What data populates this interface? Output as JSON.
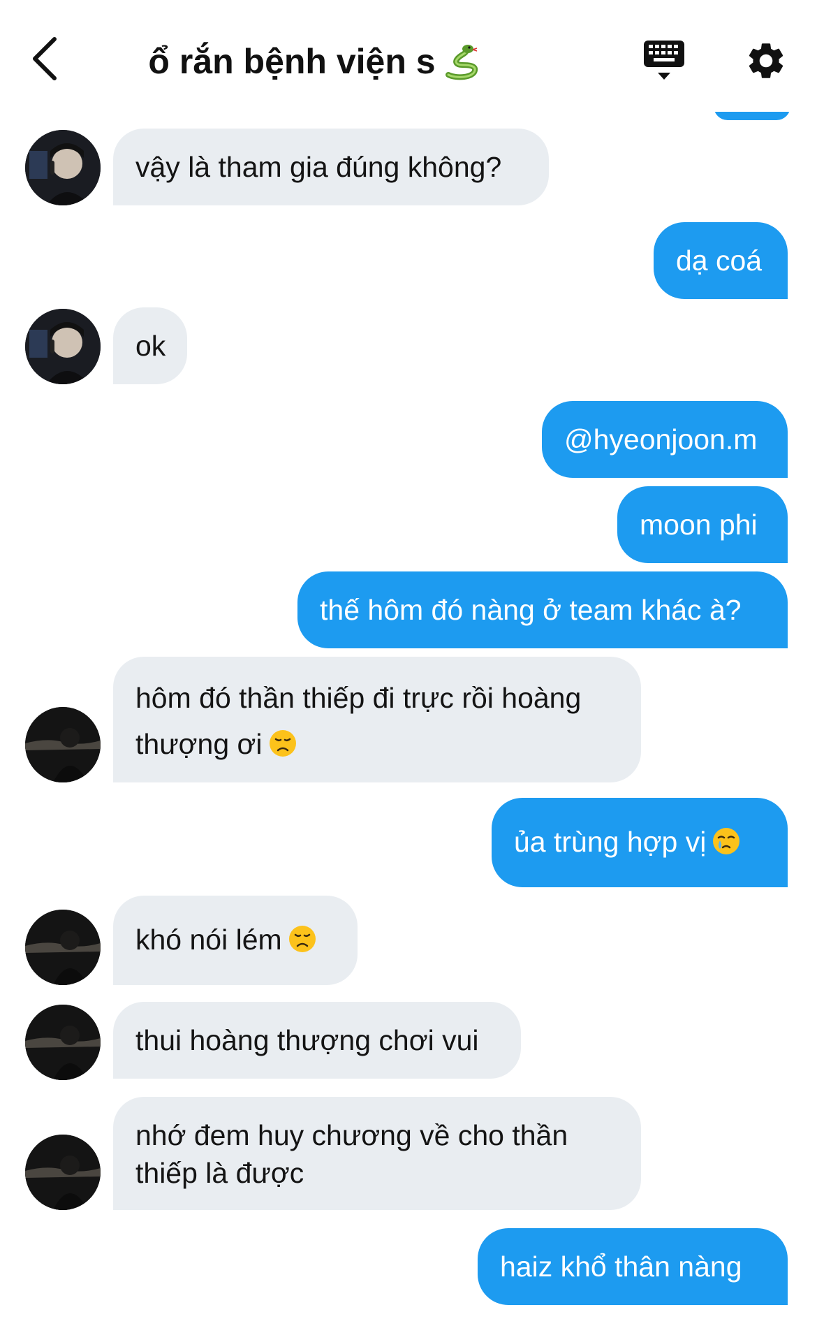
{
  "header": {
    "title": "ổ rắn bệnh viện s",
    "title_emoji": "snake-icon"
  },
  "messages": [
    {
      "direction": "in",
      "text": "vậy là tham gia đúng không?",
      "avatar": "avatar-photo-1"
    },
    {
      "direction": "out",
      "text": "dạ coá"
    },
    {
      "direction": "in",
      "text": "ok",
      "avatar": "avatar-photo-1"
    },
    {
      "direction": "out",
      "text": "@hyeonjoon.m"
    },
    {
      "direction": "out",
      "text": "moon phi"
    },
    {
      "direction": "out",
      "text": "thế hôm đó nàng ở team khác à?"
    },
    {
      "direction": "in",
      "text": "hôm đó thần thiếp đi trực rồi hoàng thượng ơi",
      "emoji": "disappointed-face-icon",
      "avatar": "avatar-photo-2"
    },
    {
      "direction": "out",
      "text": "ủa trùng hợp vị",
      "emoji": "crying-face-icon"
    },
    {
      "direction": "in",
      "text": "khó nói lém",
      "emoji": "disappointed-face-icon",
      "avatar": "avatar-photo-2"
    },
    {
      "direction": "in",
      "text": "thui hoàng thượng chơi vui",
      "avatar": "avatar-photo-2"
    },
    {
      "direction": "in",
      "text": "nhớ đem huy chương về cho thần thiếp là được",
      "avatar": "avatar-photo-2"
    },
    {
      "direction": "out",
      "text": "haiz khổ thân nàng"
    }
  ],
  "colors": {
    "outgoing_bubble": "#1d9bf0",
    "incoming_bubble": "#e9edf1",
    "background": "#ffffff"
  }
}
